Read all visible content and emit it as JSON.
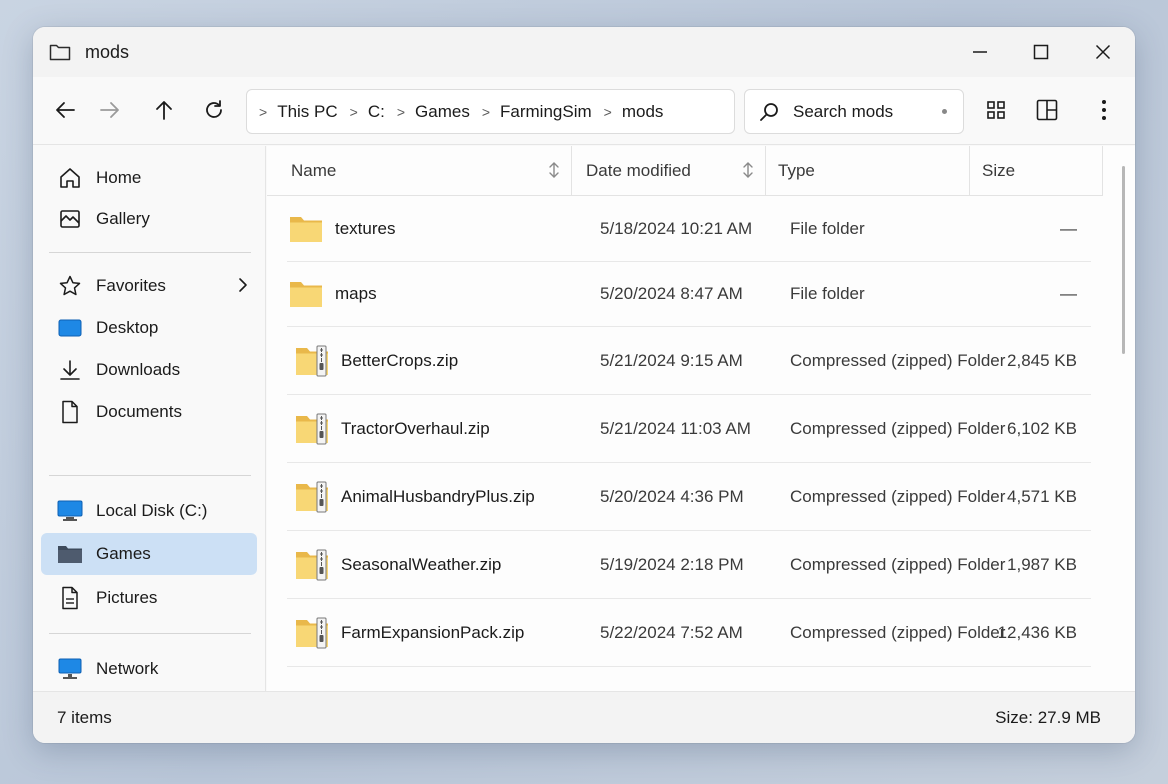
{
  "window": {
    "title": "mods",
    "controls": {
      "minimize": "minimize",
      "maximize": "maximize",
      "close": "close"
    }
  },
  "breadcrumb": [
    "This PC",
    "C:",
    "Games",
    "FarmingSim",
    "mods"
  ],
  "search": {
    "placeholder": "Search mods"
  },
  "sidebar": {
    "items": [
      {
        "label": "Home",
        "icon": "home-icon"
      },
      {
        "label": "Gallery",
        "icon": "gallery-icon"
      },
      {
        "label": "Favorites",
        "icon": "star-icon"
      },
      {
        "label": "Desktop",
        "icon": "desktop-icon"
      },
      {
        "label": "Downloads",
        "icon": "download-icon"
      },
      {
        "label": "Documents",
        "icon": "document-icon"
      },
      {
        "label": "Local Disk (C:)",
        "icon": "local-disk-icon"
      },
      {
        "label": "Games",
        "icon": "folder-icon",
        "active": true
      },
      {
        "label": "Pictures",
        "icon": "pictures-icon"
      },
      {
        "label": "Network",
        "icon": "network-icon"
      }
    ]
  },
  "columns": {
    "name": "Name",
    "date": "Date modified",
    "type": "Type",
    "size": "Size"
  },
  "files": [
    {
      "name": "textures",
      "date": "5/18/2024 10:21 AM",
      "type": "File folder",
      "size": "—",
      "kind": "folder"
    },
    {
      "name": "maps",
      "date": "5/20/2024 8:47 AM",
      "type": "File folder",
      "size": "—",
      "kind": "folder"
    },
    {
      "name": "BetterCrops.zip",
      "date": "5/21/2024 9:15 AM",
      "type": "Compressed (zipped) Folder",
      "size": "2,845 KB",
      "kind": "zip"
    },
    {
      "name": "TractorOverhaul.zip",
      "date": "5/21/2024 11:03 AM",
      "type": "Compressed (zipped) Folder",
      "size": "6,102 KB",
      "kind": "zip"
    },
    {
      "name": "AnimalHusbandryPlus.zip",
      "date": "5/20/2024 4:36 PM",
      "type": "Compressed (zipped) Folder",
      "size": "4,571 KB",
      "kind": "zip"
    },
    {
      "name": "SeasonalWeather.zip",
      "date": "5/19/2024 2:18 PM",
      "type": "Compressed (zipped) Folder",
      "size": "1,987 KB",
      "kind": "zip"
    },
    {
      "name": "FarmExpansionPack.zip",
      "date": "5/22/2024 7:52 AM",
      "type": "Compressed (zipped) Folder",
      "size": "12,436 KB",
      "kind": "zip"
    }
  ],
  "status": {
    "items": "7 items",
    "size": "Size: 27.9 MB"
  },
  "colors": {
    "accent_selection": "#cce0f5",
    "folder_yellow": "#f8d775"
  }
}
